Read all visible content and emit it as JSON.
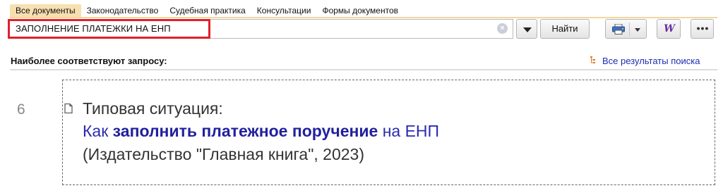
{
  "tabs": [
    {
      "label": "Все документы",
      "active": true
    },
    {
      "label": "Законодательство",
      "active": false
    },
    {
      "label": "Судебная практика",
      "active": false
    },
    {
      "label": "Консультации",
      "active": false
    },
    {
      "label": "Формы документов",
      "active": false
    }
  ],
  "search": {
    "query": "ЗАПОЛНЕНИЕ ПЛАТЕЖКИ НА ЕНП",
    "find_label": "Найти",
    "clear_icon": "clear-icon",
    "highlight_color": "#e0202a"
  },
  "toolbar": {
    "print_icon": "printer-icon",
    "word_label": "W",
    "more_label": "•••"
  },
  "results": {
    "title": "Наиболее соответствуют запросу:",
    "all_results_label": "Все результаты поиска",
    "items": [
      {
        "number": "6",
        "type": "Типовая ситуация:",
        "title_parts": [
          {
            "text": "Как ",
            "bold": false
          },
          {
            "text": "заполнить платежное поручение",
            "bold": true
          },
          {
            "text": " на ЕНП",
            "bold": false
          }
        ],
        "source": "(Издательство \"Главная книга\", 2023)"
      }
    ]
  },
  "colors": {
    "tab_active": "#f7e0b0",
    "link": "#1b2db3"
  }
}
